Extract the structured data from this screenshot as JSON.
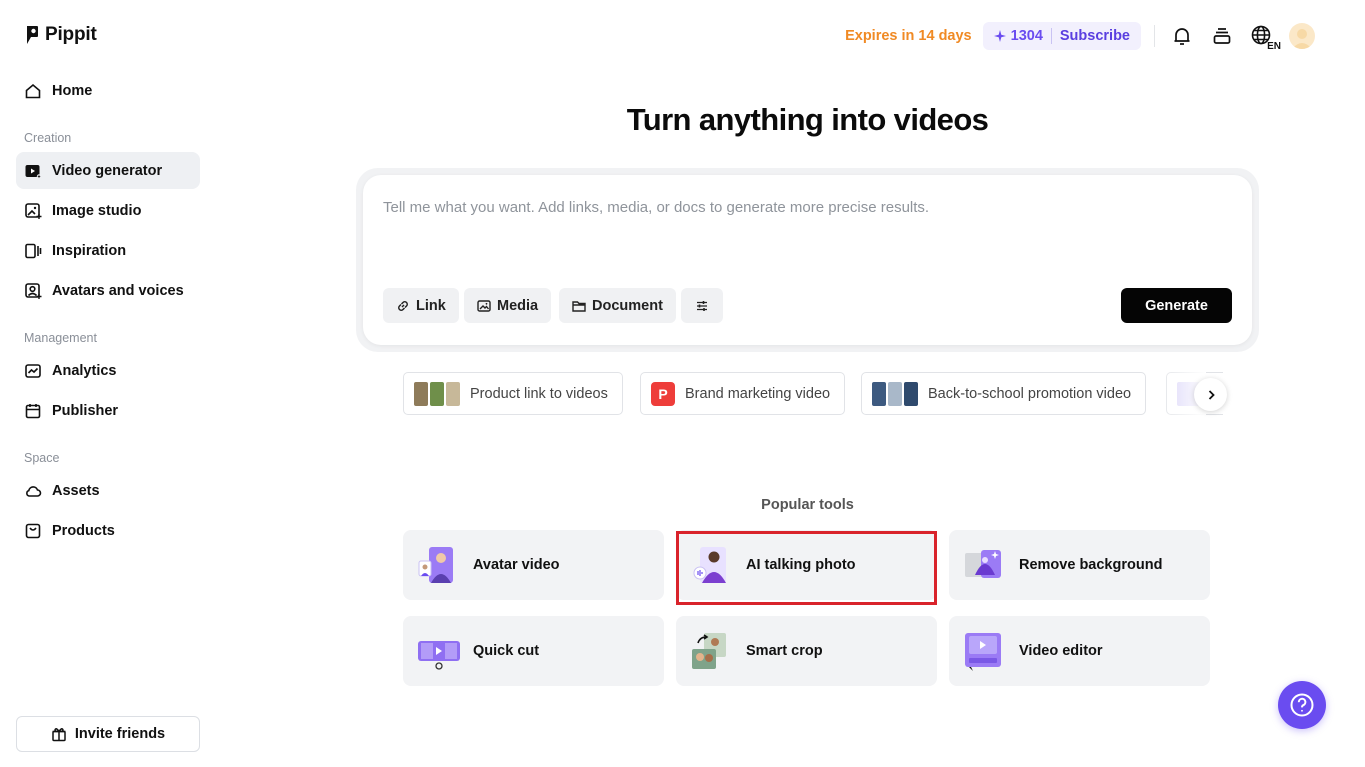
{
  "app": {
    "name": "Pippit"
  },
  "sidebar": {
    "home": "Home",
    "sections": {
      "creation": "Creation",
      "management": "Management",
      "space": "Space"
    },
    "items": {
      "video_generator": "Video generator",
      "image_studio": "Image studio",
      "inspiration": "Inspiration",
      "avatars_voices": "Avatars and voices",
      "analytics": "Analytics",
      "publisher": "Publisher",
      "assets": "Assets",
      "products": "Products"
    },
    "active_item": "Video generator",
    "invite": "Invite friends"
  },
  "header": {
    "expires": "Expires in 14 days",
    "credits": "1304",
    "subscribe": "Subscribe",
    "language": "EN"
  },
  "main": {
    "title": "Turn anything into videos",
    "prompt": {
      "value": "",
      "placeholder": "Tell me what you want. Add links, media, or docs to generate more precise results."
    },
    "chips": {
      "link": "Link",
      "media": "Media",
      "document": "Document"
    },
    "generate": "Generate",
    "suggestions": [
      "Product link to videos",
      "Brand marketing video",
      "Back-to-school promotion video"
    ],
    "brand_badge": "P",
    "popular_title": "Popular tools",
    "tools": [
      "Avatar video",
      "AI talking photo",
      "Remove background",
      "Quick cut",
      "Smart crop",
      "Video editor"
    ]
  },
  "colors": {
    "accent": "#6a4cf0",
    "expires": "#f08a24",
    "highlight": "#d9232b",
    "active_bg": "#eef0f3"
  },
  "icons": {
    "header": [
      "bell-icon",
      "stack-icon",
      "globe-icon",
      "avatar"
    ],
    "help": "question-icon"
  }
}
